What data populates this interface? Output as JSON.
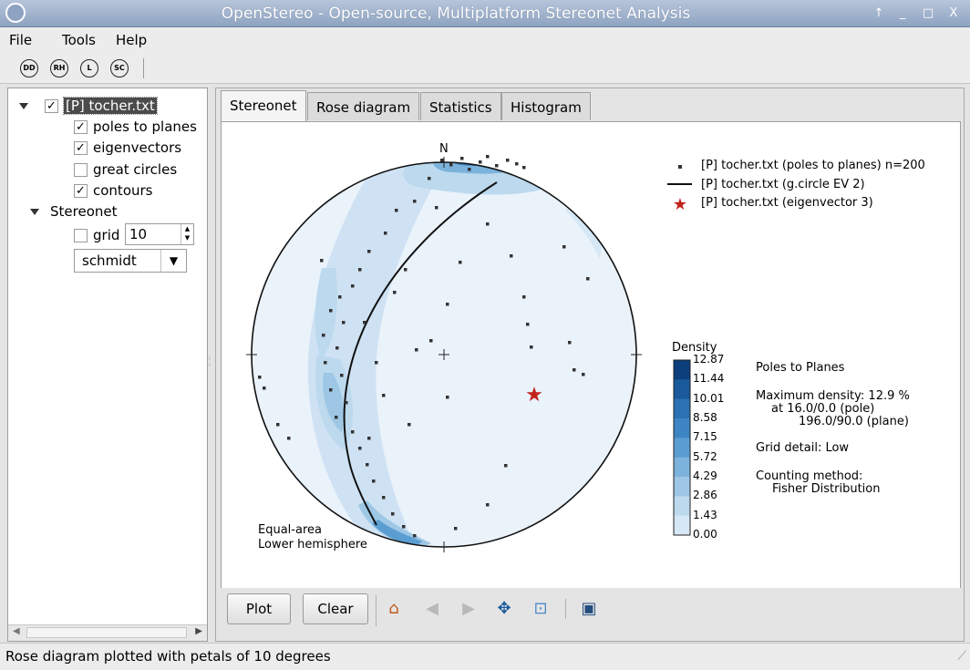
{
  "window": {
    "title": "OpenStereo - Open-source, Multiplatform Stereonet Analysis",
    "controls": [
      "↑",
      "_",
      "□",
      "X"
    ]
  },
  "menu": {
    "file": "File",
    "tools": "Tools",
    "help": "Help"
  },
  "toolbar": {
    "dd": "DD",
    "rh": "RH",
    "l": "L",
    "sc": "SC"
  },
  "tree": {
    "dataset": "[P] tocher.txt",
    "poles": "poles to planes",
    "eigenvectors": "eigenvectors",
    "great_circles": "great circles",
    "contours": "contours",
    "stereonet": "Stereonet",
    "grid": "grid",
    "grid_value": "10",
    "projection": "schmidt"
  },
  "tabs": {
    "stereonet": "Stereonet",
    "rose": "Rose diagram",
    "statistics": "Statistics",
    "histogram": "Histogram"
  },
  "plot": {
    "north": "N",
    "projection_line1": "Equal-area",
    "projection_line2": "Lower hemisphere",
    "legend": {
      "poles": "[P] tocher.txt (poles to planes) n=200",
      "gcircle": "[P] tocher.txt (g.circle EV 2)",
      "eigenvector": "[P] tocher.txt (eigenvector 3)"
    },
    "density_title": "Density",
    "density_ticks": [
      "12.87",
      "11.44",
      "10.01",
      "8.58",
      "7.15",
      "5.72",
      "4.29",
      "2.86",
      "1.43",
      "0.00"
    ],
    "density_colors": [
      "#0d3f7c",
      "#1a5a9c",
      "#2a72b3",
      "#3d86c3",
      "#5a9dd1",
      "#7cb3dc",
      "#9dc7e5",
      "#bcd9ee",
      "#d6e7f5",
      "#eef5fb"
    ],
    "info": {
      "line1": "Poles to Planes",
      "line2": "Maximum density: 12.9 %",
      "line3": "at 16.0/0.0 (pole)",
      "line4": "196.0/90.0 (plane)",
      "line5": "Grid detail: Low",
      "line6": "Counting method:",
      "line7": "Fisher Distribution"
    }
  },
  "buttons": {
    "plot": "Plot",
    "clear": "Clear"
  },
  "status": "Rose diagram plotted with petals of 10 degrees"
}
